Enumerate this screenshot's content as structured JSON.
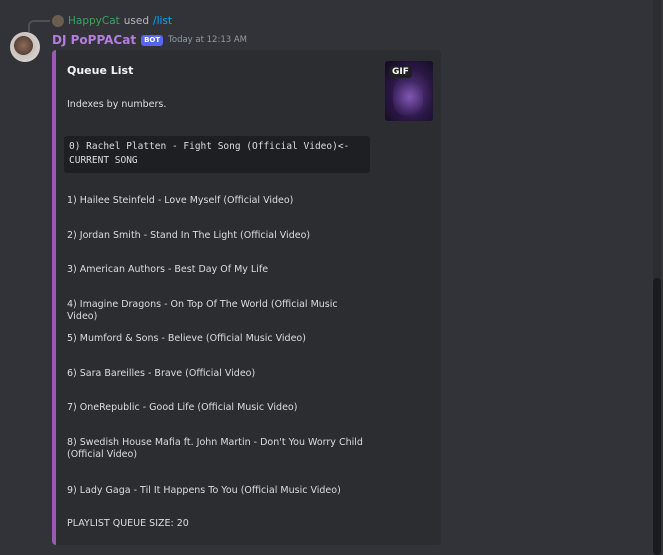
{
  "reply": {
    "user": "HappyCat",
    "used_text": "used",
    "command": "/list"
  },
  "message": {
    "author": "DJ PoPPACat",
    "badge": "BOT",
    "timestamp": "Today at 12:13 AM"
  },
  "embed": {
    "title": "Queue List",
    "description": "Indexes by numbers.",
    "thumbnail_badge": "GIF",
    "current_song_block": "0) Rachel Platten - Fight Song (Official Video)<-\nCURRENT SONG",
    "songs": [
      "1) Hailee Steinfeld - Love Myself (Official Video)",
      "2) Jordan Smith - Stand In The Light (Official Video)",
      "3) American Authors - Best Day Of My Life",
      "4) Imagine Dragons - On Top Of The World (Official Music Video)",
      "5) Mumford & Sons - Believe (Official Music Video)",
      "6) Sara Bareilles - Brave (Official Video)",
      "7) OneRepublic - Good Life (Official Music Video)",
      "8) Swedish House Mafia ft. John Martin - Don't You Worry Child (Official Video)",
      "9) Lady Gaga - Til It Happens To You (Official Music Video)"
    ],
    "footer": "PLAYLIST QUEUE SIZE: 20"
  },
  "colors": {
    "background": "#313338",
    "embed_bg": "#2b2d31",
    "embed_accent": "#9b59b6",
    "author": "#b57edc",
    "reply_user": "#3ba55c",
    "command": "#00a8fc",
    "bot_badge": "#5865f2"
  }
}
